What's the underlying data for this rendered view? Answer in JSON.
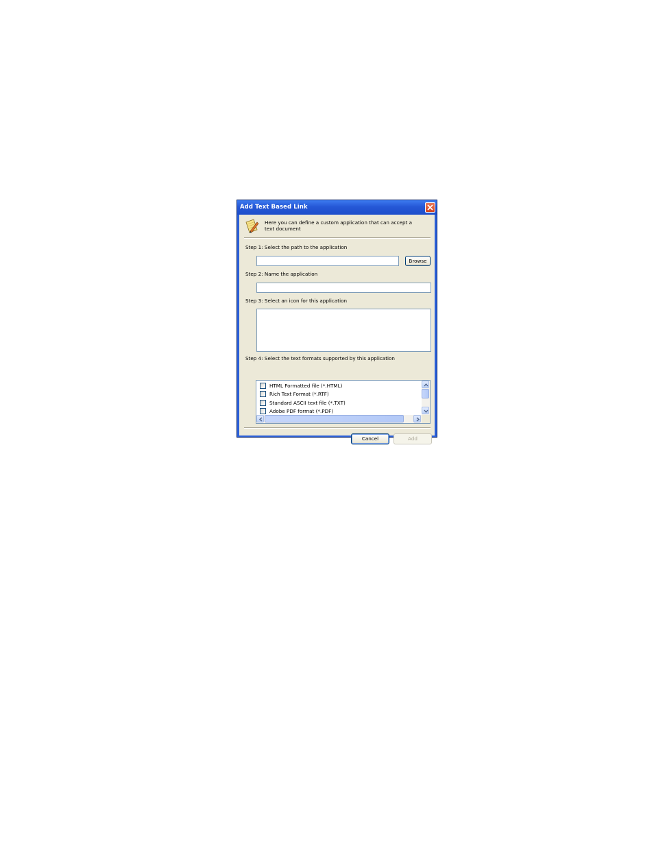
{
  "dialog": {
    "title": "Add Text Based Link",
    "close_icon": "close-icon",
    "header_text": "Here you can define a custom application that can accept a text document",
    "header_icon": "notepad-pencil-icon"
  },
  "step1": {
    "label": "Step 1: Select the path to the application",
    "path_value": "",
    "browse_label": "Browse"
  },
  "step2": {
    "label": "Step 2: Name the application",
    "name_value": ""
  },
  "step3": {
    "label": "Step 3: Select an icon for this application"
  },
  "step4": {
    "label": "Step 4: Select the text formats supported by this application",
    "formats": [
      {
        "label": "HTML Formatted file (*.HTML)",
        "checked": false
      },
      {
        "label": "Rich Text Format (*.RTF)",
        "checked": false
      },
      {
        "label": "Standard ASCII text file (*.TXT)",
        "checked": false
      },
      {
        "label": "Adobe PDF format (*.PDF)",
        "checked": false
      }
    ]
  },
  "footer": {
    "cancel_label": "Cancel",
    "add_label": "Add"
  },
  "colors": {
    "titlebar": "#2558d6",
    "client": "#ece9d8",
    "close": "#d4421c"
  }
}
